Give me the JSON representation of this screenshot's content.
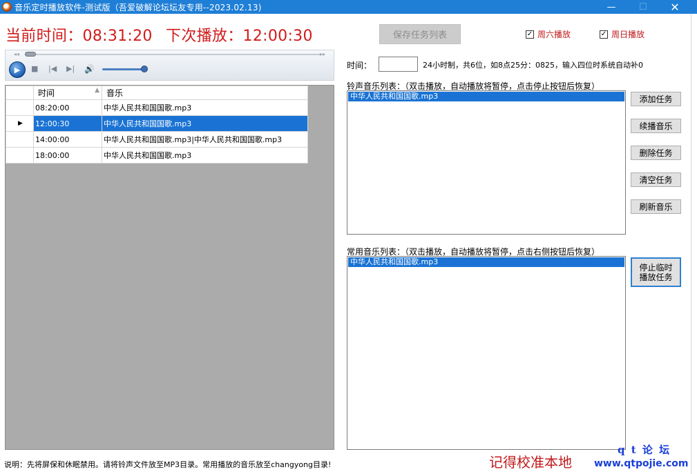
{
  "window": {
    "title": "音乐定时播放软件-测试版（吾爱破解论坛坛友专用--2023.02.13)",
    "min_icon": "minimize-icon",
    "max_icon": "maximize-icon",
    "close_icon": "close-icon"
  },
  "clock": {
    "current_label": "当前时间：",
    "current_time": "08:31:20",
    "next_label": "下次播放：",
    "next_time": "12:00:30"
  },
  "toolbar": {
    "save_label": "保存任务列表",
    "saturday_label": "周六播放",
    "saturday_checked": true,
    "sunday_label": "周日播放",
    "sunday_checked": true
  },
  "player": {
    "play_icon": "play-icon",
    "stop_icon": "stop-icon",
    "prev_icon": "previous-icon",
    "next_icon": "next-icon",
    "volume_icon": "volume-icon",
    "seek_fraction": 0.0,
    "volume_fraction": 0.9
  },
  "grid": {
    "columns": [
      "时间",
      "音乐"
    ],
    "rows": [
      {
        "time": "08:20:00",
        "music": "中华人民共和国国歌.mp3",
        "selected": false
      },
      {
        "time": "12:00:30",
        "music": "中华人民共和国国歌.mp3",
        "selected": true
      },
      {
        "time": "14:00:00",
        "music": "中华人民共和国国歌.mp3|中华人民共和国国歌.mp3",
        "selected": false
      },
      {
        "time": "18:00:00",
        "music": "中华人民共和国国歌.mp3",
        "selected": false
      }
    ]
  },
  "time_entry": {
    "label": "时间：",
    "value": "",
    "hint": "24小时制，共6位，如8点25分：0825，输入四位时系统自动补0"
  },
  "ringtone_list": {
    "label": "铃声音乐列表：（双击播放，自动播放将暂停，点击停止按钮后恢复）",
    "items": [
      "中华人民共和国国歌.mp3"
    ]
  },
  "common_list": {
    "label": "常用音乐列表：（双击播放，自动播放将暂停，点击右侧按钮后恢复）",
    "items": [
      "中华人民共和国国歌.mp3"
    ]
  },
  "actions": {
    "add": "添加任务",
    "continue": "续播音乐",
    "delete": "删除任务",
    "clear": "清空任务",
    "refresh": "刷新音乐",
    "stop_temp": "停止临时播放任务"
  },
  "footer": {
    "note": "说明：先将屏保和休眠禁用。请将铃声文件放至MP3目录。常用播放的音乐放至changyong目录!",
    "watermark": "记得校准本地",
    "logo_top": "q t 论 坛",
    "logo_bottom": "www.qtpojie.com"
  }
}
